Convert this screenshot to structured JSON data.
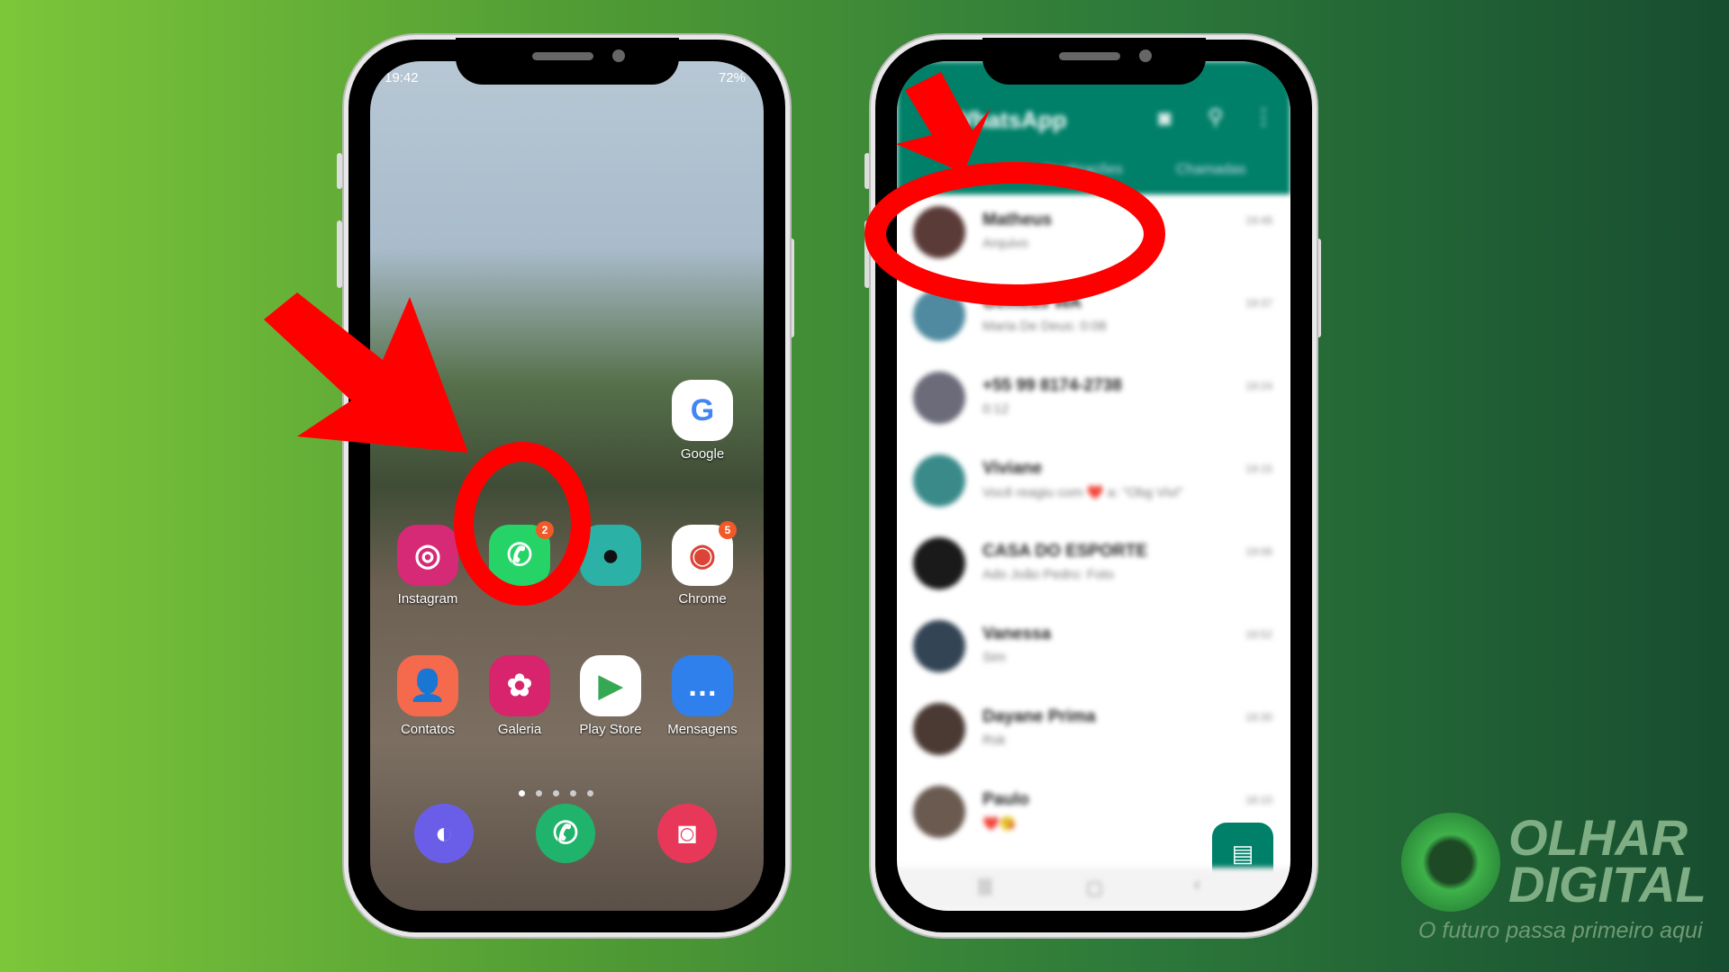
{
  "left_phone": {
    "status": {
      "time": "19:42",
      "battery": "72%"
    },
    "apps": [
      {
        "label": "Google",
        "icon": "google-icon",
        "color": "#ffffff"
      },
      {
        "label": "Instagram",
        "icon": "instagram-icon",
        "color": "#d62976"
      },
      {
        "label": "",
        "icon": "whatsapp-icon",
        "color": "#25d366",
        "badge": "2"
      },
      {
        "label": "",
        "icon": "camera-app-icon",
        "color": "#2bb1a5"
      },
      {
        "label": "Chrome",
        "icon": "chrome-icon",
        "color": "#ffffff",
        "badge": "5"
      },
      {
        "label": "Contatos",
        "icon": "contacts-icon",
        "color": "#f56a4c"
      },
      {
        "label": "Galeria",
        "icon": "gallery-icon",
        "color": "#d8246c"
      },
      {
        "label": "Play Store",
        "icon": "play-store-icon",
        "color": "#ffffff"
      },
      {
        "label": "Mensagens",
        "icon": "messages-icon",
        "color": "#2f80ed"
      }
    ],
    "dock": [
      {
        "icon": "internet-browser-icon",
        "color": "#6a5ee8"
      },
      {
        "icon": "phone-icon",
        "color": "#1fb36b"
      },
      {
        "icon": "camera-icon",
        "color": "#e8385a"
      }
    ]
  },
  "right_phone": {
    "header_title": "WhatsApp",
    "tabs": [
      "Atualizações",
      "Chamadas"
    ],
    "accent": "#008069",
    "chats": [
      {
        "name": "Matheus",
        "preview": "Arquivo",
        "time": "19:48"
      },
      {
        "name": "Gêmeas WA",
        "preview": "Maria De Deus: 0:08",
        "time": "19:37"
      },
      {
        "name": "+55 99 8174-2738",
        "preview": "0:12",
        "time": "19:24"
      },
      {
        "name": "Viviane",
        "preview": "Você reagiu com ❤️ a: \"Obg Vivi\"",
        "time": "19:15"
      },
      {
        "name": "CASA DO ESPORTE",
        "preview": "Ado João Pedro: Foto",
        "time": "19:06"
      },
      {
        "name": "Vanessa",
        "preview": "Sim",
        "time": "18:52"
      },
      {
        "name": "Dayane Prima",
        "preview": "Rsk",
        "time": "18:30"
      },
      {
        "name": "Paulo",
        "preview": "❤️😘",
        "time": "18:10"
      }
    ]
  },
  "annotation_color": "#ff0000",
  "logo": {
    "line1": "OLHAR",
    "line2": "DIGITAL",
    "tagline": "O futuro passa primeiro aqui"
  }
}
